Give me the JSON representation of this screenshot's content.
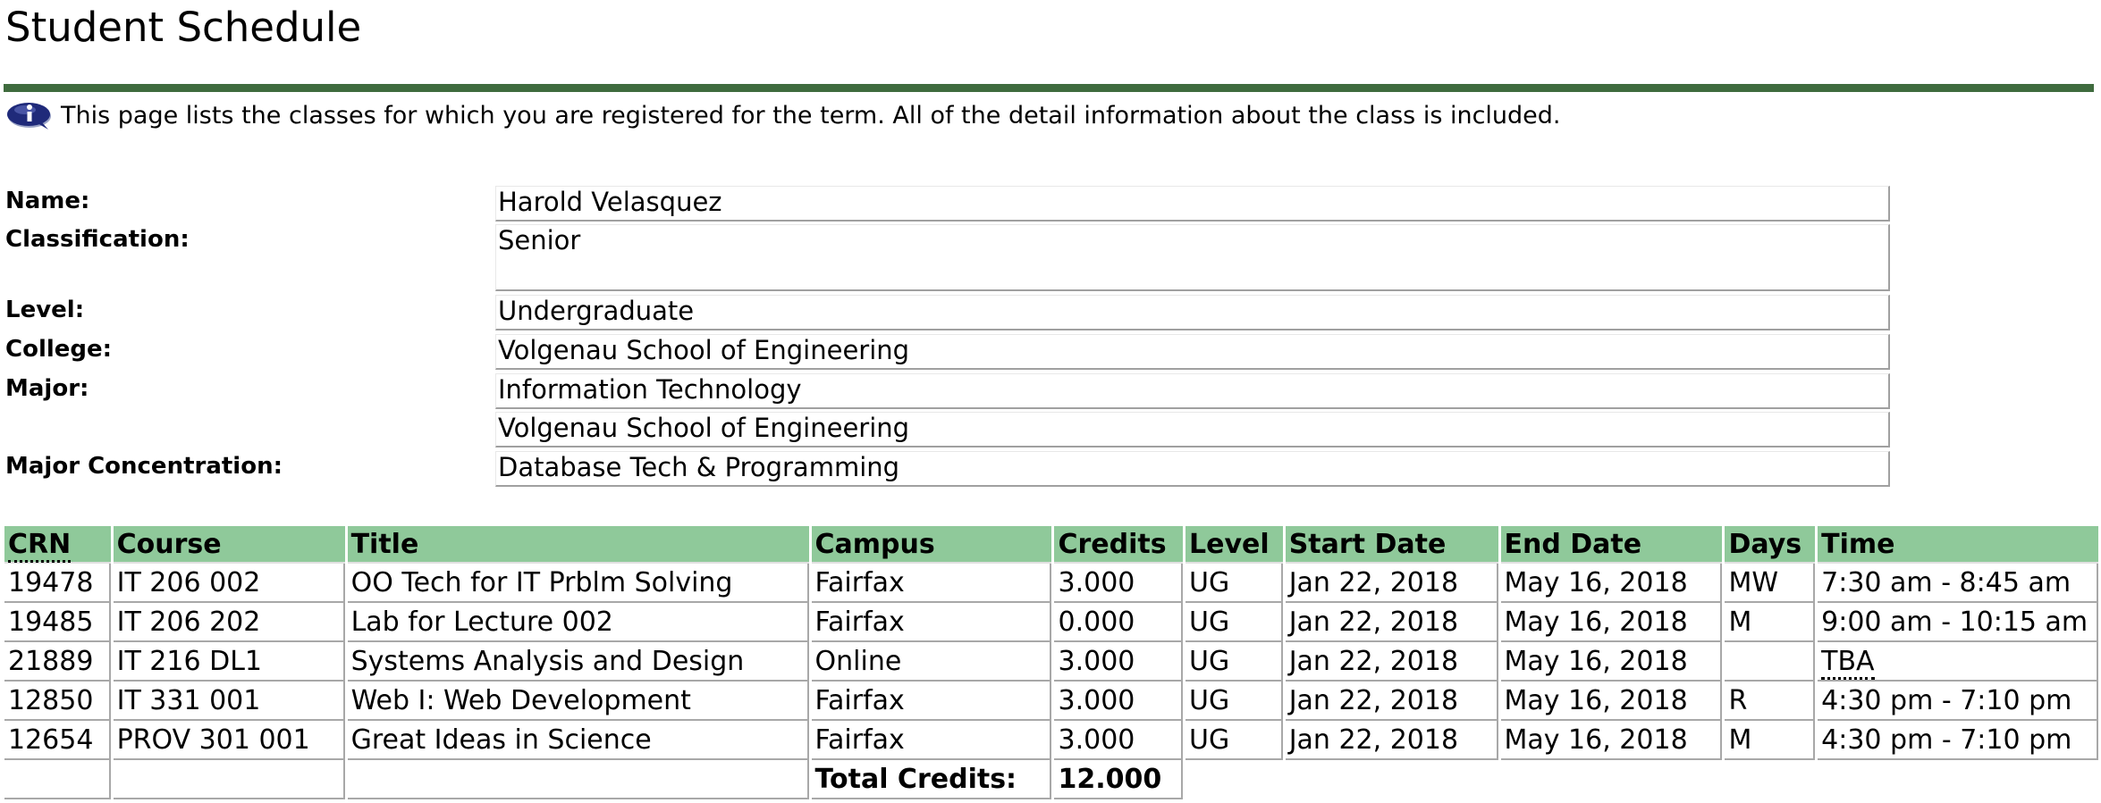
{
  "page": {
    "title": "Student Schedule",
    "info_text": "This page lists the classes for which you are registered for the term. All of the detail information about the class is included.",
    "info_icon": "info-icon",
    "accent_color": "#3f6b3e",
    "header_color": "#8fc99a"
  },
  "student": {
    "name_label": "Name:",
    "name": "Harold Velasquez",
    "classification_label": "Classification:",
    "classification": "Senior",
    "level_label": "Level:",
    "level": "Undergraduate",
    "college_label": "College:",
    "college": "Volgenau School of Engineering",
    "major_label": "Major:",
    "major": "Information Technology",
    "major_college": "Volgenau School of Engineering",
    "concentration_label": "Major Concentration:",
    "concentration": "Database Tech & Programming"
  },
  "schedule": {
    "headers": [
      "CRN",
      "Course",
      "Title",
      "Campus",
      "Credits",
      "Level",
      "Start Date",
      "End Date",
      "Days",
      "Time"
    ],
    "rows": [
      {
        "crn": "19478",
        "course": "IT 206 002",
        "title": "OO Tech for IT Prblm Solving",
        "campus": "Fairfax",
        "credits": "3.000",
        "level": "UG",
        "start": "Jan 22, 2018",
        "end": "May 16, 2018",
        "days": "MW",
        "time": "7:30 am - 8:45 am"
      },
      {
        "crn": "19485",
        "course": "IT 206 202",
        "title": "Lab for Lecture 002",
        "campus": "Fairfax",
        "credits": "0.000",
        "level": "UG",
        "start": "Jan 22, 2018",
        "end": "May 16, 2018",
        "days": "M",
        "time": "9:00 am - 10:15 am"
      },
      {
        "crn": "21889",
        "course": "IT 216 DL1",
        "title": "Systems Analysis and Design",
        "campus": "Online",
        "credits": "3.000",
        "level": "UG",
        "start": "Jan 22, 2018",
        "end": "May 16, 2018",
        "days": "",
        "time": "TBA"
      },
      {
        "crn": "12850",
        "course": "IT 331 001",
        "title": "Web I: Web Development",
        "campus": "Fairfax",
        "credits": "3.000",
        "level": "UG",
        "start": "Jan 22, 2018",
        "end": "May 16, 2018",
        "days": "R",
        "time": "4:30 pm - 7:10 pm"
      },
      {
        "crn": "12654",
        "course": "PROV 301 001",
        "title": "Great Ideas in Science",
        "campus": "Fairfax",
        "credits": "3.000",
        "level": "UG",
        "start": "Jan 22, 2018",
        "end": "May 16, 2018",
        "days": "M",
        "time": "4:30 pm - 7:10 pm"
      }
    ],
    "total_label": "Total Credits:",
    "total_value": "12.000"
  }
}
